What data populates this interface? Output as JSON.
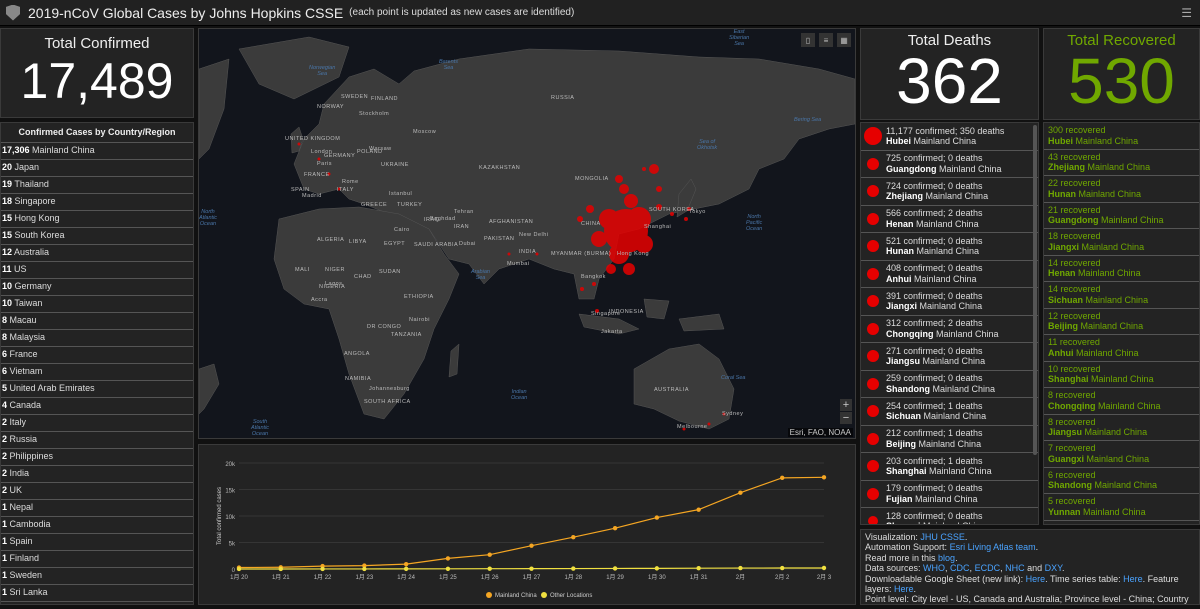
{
  "header": {
    "title": "2019-nCoV Global Cases by Johns Hopkins CSSE",
    "subtitle": "(each point is updated as new cases are identified)"
  },
  "total_confirmed": {
    "label": "Total Confirmed",
    "value": "17,489"
  },
  "country_list": {
    "title": "Confirmed Cases by Country/Region",
    "items": [
      {
        "count": "17,306",
        "name": "Mainland China"
      },
      {
        "count": "20",
        "name": "Japan"
      },
      {
        "count": "19",
        "name": "Thailand"
      },
      {
        "count": "18",
        "name": "Singapore"
      },
      {
        "count": "15",
        "name": "Hong Kong"
      },
      {
        "count": "15",
        "name": "South Korea"
      },
      {
        "count": "12",
        "name": "Australia"
      },
      {
        "count": "11",
        "name": "US"
      },
      {
        "count": "10",
        "name": "Germany"
      },
      {
        "count": "10",
        "name": "Taiwan"
      },
      {
        "count": "8",
        "name": "Macau"
      },
      {
        "count": "8",
        "name": "Malaysia"
      },
      {
        "count": "6",
        "name": "France"
      },
      {
        "count": "6",
        "name": "Vietnam"
      },
      {
        "count": "5",
        "name": "United Arab Emirates"
      },
      {
        "count": "4",
        "name": "Canada"
      },
      {
        "count": "2",
        "name": "Italy"
      },
      {
        "count": "2",
        "name": "Russia"
      },
      {
        "count": "2",
        "name": "Philippines"
      },
      {
        "count": "2",
        "name": "India"
      },
      {
        "count": "2",
        "name": "UK"
      },
      {
        "count": "1",
        "name": "Nepal"
      },
      {
        "count": "1",
        "name": "Cambodia"
      },
      {
        "count": "1",
        "name": "Spain"
      },
      {
        "count": "1",
        "name": "Finland"
      },
      {
        "count": "1",
        "name": "Sweden"
      },
      {
        "count": "1",
        "name": "Sri Lanka"
      }
    ]
  },
  "map": {
    "attribution": "Esri, FAO, NOAA",
    "zoom_in": "+",
    "zoom_out": "−",
    "labels": {
      "russia": "RUSSIA",
      "finland": "FINLAND",
      "sweden": "SWEDEN",
      "norway": "NORWAY",
      "uk": "UNITED KINGDOM",
      "germany": "GERMANY",
      "poland": "POLAND",
      "ukraine": "UKRAINE",
      "france": "FRANCE",
      "spain": "SPAIN",
      "italy": "ITALY",
      "greece": "GREECE",
      "turkey": "TURKEY",
      "kazakhstan": "KAZAKHSTAN",
      "mongolia": "MONGOLIA",
      "china": "CHINA",
      "japan_l": "JAPAN",
      "s_korea": "SOUTH KOREA",
      "iran": "IRAN",
      "iraq": "IRAQ",
      "afghanistan": "AFGHANISTAN",
      "pakistan": "PAKISTAN",
      "india": "INDIA",
      "myanmar": "MYANMAR (BURMA)",
      "thailand": "THAILAND",
      "algeria": "ALGERIA",
      "libya": "LIBYA",
      "egypt": "EGYPT",
      "saudi": "SAUDI ARABIA",
      "mali": "MALI",
      "niger": "NIGER",
      "chad": "CHAD",
      "sudan": "SUDAN",
      "nigeria": "NIGERIA",
      "ethiopia": "ETHIOPIA",
      "drc": "DR CONGO",
      "tanzania": "TANZANIA",
      "angola": "ANGOLA",
      "namibia": "NAMIBIA",
      "south_africa": "SOUTH AFRICA",
      "australia": "AUSTRALIA",
      "indonesia": "INDONESIA",
      "moscow": "Moscow",
      "stockholm": "Stockholm",
      "london": "London",
      "paris": "Paris",
      "warsaw": "Warsaw",
      "madrid": "Madrid",
      "rome": "Rome",
      "istanbul": "Istanbul",
      "cairo": "Cairo",
      "baghdad": "Baghdad",
      "dubai": "Dubai",
      "tehran": "Tehran",
      "newdelhi": "New Delhi",
      "mumbai": "Mumbai",
      "bangkok": "Bangkok",
      "singapore": "Singapore",
      "jakarta": "Jakarta",
      "shanghai": "Shanghai",
      "tokyo": "Tokyo",
      "hongkong": "Hong Kong",
      "accra": "Accra",
      "johannesburg": "Johannesburg",
      "sydney": "Sydney",
      "melbourne": "Melbourne",
      "lagos": "Lagos",
      "nairobi": "Nairobi"
    },
    "oceans": {
      "norwegian": "Norwegian\nSea",
      "barents": "Barents\nSea",
      "north_atlantic": "North\nAtlantic\nOcean",
      "south_atlantic": "South\nAtlantic\nOcean",
      "arabian": "Arabian\nSea",
      "indian": "Indian\nOcean",
      "north_pacific": "North\nPacific\nOcean",
      "okhotsk": "Sea of\nOkhotsk",
      "bering": "Bering Sea",
      "coral": "Coral Sea",
      "east_siberian": "East\nSiberian\nSea"
    }
  },
  "total_deaths": {
    "label": "Total Deaths",
    "value": "362"
  },
  "deaths_list": [
    {
      "stats": "11,177 confirmed; 350 deaths",
      "province": "Hubei",
      "country": "Mainland China"
    },
    {
      "stats": "725 confirmed; 0 deaths",
      "province": "Guangdong",
      "country": "Mainland China"
    },
    {
      "stats": "724 confirmed; 0 deaths",
      "province": "Zhejiang",
      "country": "Mainland China"
    },
    {
      "stats": "566 confirmed; 2 deaths",
      "province": "Henan",
      "country": "Mainland China"
    },
    {
      "stats": "521 confirmed; 0 deaths",
      "province": "Hunan",
      "country": "Mainland China"
    },
    {
      "stats": "408 confirmed; 0 deaths",
      "province": "Anhui",
      "country": "Mainland China"
    },
    {
      "stats": "391 confirmed; 0 deaths",
      "province": "Jiangxi",
      "country": "Mainland China"
    },
    {
      "stats": "312 confirmed; 2 deaths",
      "province": "Chongqing",
      "country": "Mainland China"
    },
    {
      "stats": "271 confirmed; 0 deaths",
      "province": "Jiangsu",
      "country": "Mainland China"
    },
    {
      "stats": "259 confirmed; 0 deaths",
      "province": "Shandong",
      "country": "Mainland China"
    },
    {
      "stats": "254 confirmed; 1 deaths",
      "province": "Sichuan",
      "country": "Mainland China"
    },
    {
      "stats": "212 confirmed; 1 deaths",
      "province": "Beijing",
      "country": "Mainland China"
    },
    {
      "stats": "203 confirmed; 1 deaths",
      "province": "Shanghai",
      "country": "Mainland China"
    },
    {
      "stats": "179 confirmed; 0 deaths",
      "province": "Fujian",
      "country": "Mainland China"
    },
    {
      "stats": "128 confirmed; 0 deaths",
      "province": "Shaanxi",
      "country": "Mainland China"
    }
  ],
  "total_recovered": {
    "label": "Total Recovered",
    "value": "530"
  },
  "recovered_list": [
    {
      "stats": "300 recovered",
      "province": "Hubei",
      "country": "Mainland China"
    },
    {
      "stats": "43 recovered",
      "province": "Zhejiang",
      "country": "Mainland China"
    },
    {
      "stats": "22 recovered",
      "province": "Hunan",
      "country": "Mainland China"
    },
    {
      "stats": "21 recovered",
      "province": "Guangdong",
      "country": "Mainland China"
    },
    {
      "stats": "18 recovered",
      "province": "Jiangxi",
      "country": "Mainland China"
    },
    {
      "stats": "14 recovered",
      "province": "Henan",
      "country": "Mainland China"
    },
    {
      "stats": "14 recovered",
      "province": "Sichuan",
      "country": "Mainland China"
    },
    {
      "stats": "12 recovered",
      "province": "Beijing",
      "country": "Mainland China"
    },
    {
      "stats": "11 recovered",
      "province": "Anhui",
      "country": "Mainland China"
    },
    {
      "stats": "10 recovered",
      "province": "Shanghai",
      "country": "Mainland China"
    },
    {
      "stats": "8 recovered",
      "province": "Chongqing",
      "country": "Mainland China"
    },
    {
      "stats": "8 recovered",
      "province": "Jiangsu",
      "country": "Mainland China"
    },
    {
      "stats": "7 recovered",
      "province": "Guangxi",
      "country": "Mainland China"
    },
    {
      "stats": "6 recovered",
      "province": "Shandong",
      "country": "Mainland China"
    },
    {
      "stats": "5 recovered",
      "province": "Yunnan",
      "country": "Mainland China"
    }
  ],
  "info": {
    "vis_prefix": "Visualization: ",
    "vis_link": "JHU CSSE",
    "auto_prefix": "Automation Support: ",
    "auto_link": "Esri Living Atlas team",
    "read_prefix": "Read more in this ",
    "read_link": "blog",
    "src_prefix": "Data sources: ",
    "src_who": "WHO",
    "src_cdc": "CDC",
    "src_ecdc": "ECDC",
    "src_nhc": "NHC",
    "src_and": " and ",
    "src_dxy": "DXY",
    "sheet_prefix": "Downloadable Google Sheet (new link): ",
    "sheet_link": "Here",
    "ts_prefix": ". Time series table: ",
    "ts_link": "Here",
    "feat_prefix": ". Feature layers: ",
    "feat_link": "Here",
    "level": "Point level: City level - US, Canada and Australia; Province level - China; Country"
  },
  "colors": {
    "mainland": "#f5a623",
    "other": "#f0e040",
    "death_dot": "#e60000",
    "recovered": "#70a800"
  },
  "chart_data": {
    "type": "line",
    "ylabel": "Total confirmed cases",
    "yticks": [
      "0",
      "5k",
      "10k",
      "15k",
      "20k"
    ],
    "ylim": [
      0,
      20000
    ],
    "categories": [
      "1月 20",
      "1月 21",
      "1月 22",
      "1月 23",
      "1月 24",
      "1月 25",
      "1月 26",
      "1月 27",
      "1月 28",
      "1月 29",
      "1月 30",
      "1月 31",
      "2月",
      "2月 2",
      "2月 3"
    ],
    "series": [
      {
        "name": "Mainland China",
        "values": [
          278,
          326,
          547,
          639,
          916,
          2000,
          2700,
          4400,
          6000,
          7700,
          9700,
          11200,
          14400,
          17200,
          17300
        ]
      },
      {
        "name": "Other Locations",
        "values": [
          4,
          6,
          8,
          14,
          25,
          40,
          57,
          64,
          87,
          105,
          118,
          153,
          173,
          183,
          190
        ]
      }
    ],
    "legend": "bottom"
  }
}
